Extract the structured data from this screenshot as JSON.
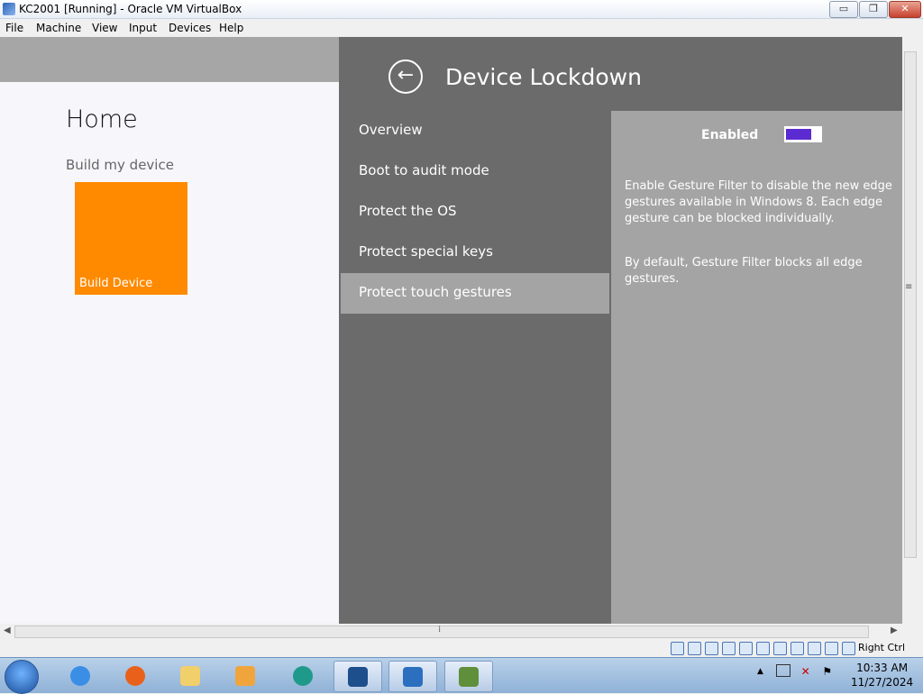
{
  "window": {
    "title": "KC2001 [Running] - Oracle VM VirtualBox",
    "buttons": {
      "minimize": "▭",
      "restore": "❐",
      "close": "✕"
    }
  },
  "menubar": [
    "File",
    "Machine",
    "View",
    "Input",
    "Devices",
    "Help"
  ],
  "home": {
    "title": "Home",
    "subtitle": "Build my device",
    "tile_label": "Build Device",
    "tile_color": "#ff8a00"
  },
  "panel": {
    "back_icon": "←",
    "heading": "Device Lockdown",
    "nav": [
      {
        "label": "Overview"
      },
      {
        "label": "Boot to audit mode"
      },
      {
        "label": "Protect the OS"
      },
      {
        "label": "Protect special keys"
      },
      {
        "label": "Protect touch gestures",
        "selected": true
      }
    ],
    "detail": {
      "enabled_label": "Enabled",
      "toggle_on": true,
      "toggle_color": "#5a2bd1",
      "description_1": "Enable Gesture Filter to disable the new edge gestures available in Windows 8. Each edge gesture can be blocked individually.",
      "description_2": "By default, Gesture Filter blocks all edge gestures."
    }
  },
  "scrollbar": {
    "h_grip": "⁞",
    "v_grip": "≡"
  },
  "statusbar": {
    "host_key": "Right Ctrl"
  },
  "taskbar": {
    "apps": [
      "internet-explorer",
      "firefox",
      "file-explorer",
      "media-player",
      "browser-teal",
      "virtualbox",
      "windows-xp-vm",
      "network-utility"
    ],
    "tray_up_arrow": "▲",
    "time": "10:33 AM",
    "date": "11/27/2024"
  },
  "colors": {
    "panel_bg": "#6b6b6b",
    "selected_bg": "#a4a4a4",
    "home_bg": "#f7f7fb"
  }
}
